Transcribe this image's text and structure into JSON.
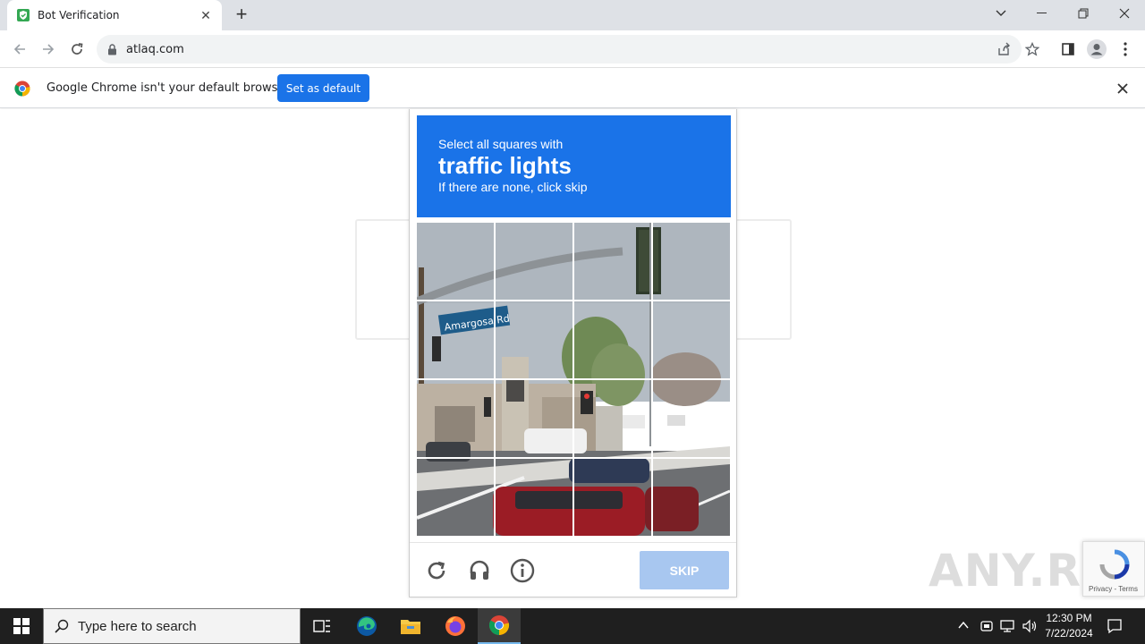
{
  "browser": {
    "tab_title": "Bot Verification",
    "url": "atlaq.com",
    "infobar_message": "Google Chrome isn't your default browser",
    "set_default_label": "Set as default"
  },
  "challenge": {
    "line1": "Select all squares with",
    "target": "traffic lights",
    "line3": "If there are none, click skip",
    "grid_rows": 4,
    "grid_cols": 4,
    "skip_label": "SKIP"
  },
  "badge": {
    "links": "Privacy - Terms"
  },
  "watermark": "ANY.RUN",
  "taskbar": {
    "search_placeholder": "Type here to search",
    "time": "12:30 PM",
    "date": "7/22/2024"
  },
  "colors": {
    "accent": "#1a73e8",
    "skip_disabled": "#a8c7f0",
    "taskbar": "#1f1f1f"
  },
  "icons": [
    "chrome-icon",
    "edge-icon",
    "file-explorer-icon",
    "firefox-icon",
    "task-view-icon",
    "windows-start-icon"
  ]
}
